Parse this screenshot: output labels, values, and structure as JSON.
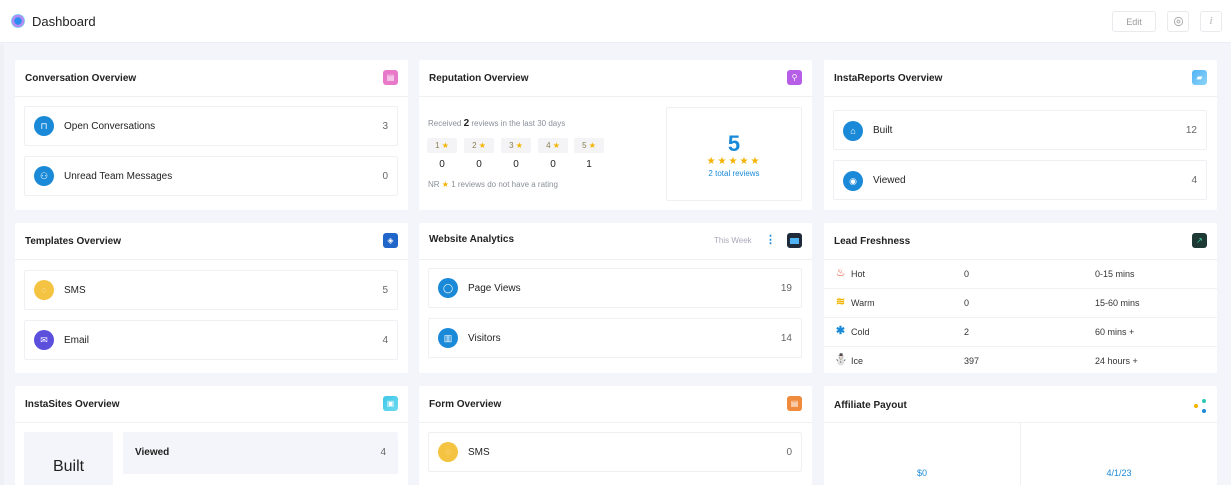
{
  "header": {
    "title": "Dashboard",
    "edit_label": "Edit",
    "settings_icon": "gear-icon",
    "info_icon": "info-icon"
  },
  "conversation": {
    "title": "Conversation Overview",
    "items": [
      {
        "label": "Open Conversations",
        "value": "3",
        "icon": "inbox-icon"
      },
      {
        "label": "Unread Team Messages",
        "value": "0",
        "icon": "team-icon"
      }
    ]
  },
  "reputation": {
    "title": "Reputation Overview",
    "received_prefix": "Received",
    "received_count": "2",
    "received_suffix": "reviews in the last 30 days",
    "ratings": [
      {
        "label": "1",
        "value": "0"
      },
      {
        "label": "2",
        "value": "0"
      },
      {
        "label": "3",
        "value": "0"
      },
      {
        "label": "4",
        "value": "0"
      },
      {
        "label": "5",
        "value": "1"
      }
    ],
    "nr_label": "NR",
    "nr_text": "1 reviews do not have a rating",
    "score": "5",
    "stars": "★★★★★",
    "total_reviews": "2 total reviews"
  },
  "instareports": {
    "title": "InstaReports Overview",
    "items": [
      {
        "label": "Built",
        "value": "12",
        "icon": "building-icon"
      },
      {
        "label": "Viewed",
        "value": "4",
        "icon": "eye-icon"
      }
    ]
  },
  "templates": {
    "title": "Templates Overview",
    "items": [
      {
        "label": "SMS",
        "value": "5",
        "icon": "sms-icon"
      },
      {
        "label": "Email",
        "value": "4",
        "icon": "email-icon"
      }
    ]
  },
  "website_analytics": {
    "title": "Website Analytics",
    "period": "This Week",
    "items": [
      {
        "label": "Page Views",
        "value": "19",
        "icon": "user-icon"
      },
      {
        "label": "Visitors",
        "value": "14",
        "icon": "building-icon"
      }
    ]
  },
  "lead_freshness": {
    "title": "Lead Freshness",
    "rows": [
      {
        "label": "Hot",
        "value": "0",
        "time": "0-15 mins",
        "icon": "flame-icon"
      },
      {
        "label": "Warm",
        "value": "0",
        "time": "15-60 mins",
        "icon": "wave-icon"
      },
      {
        "label": "Cold",
        "value": "2",
        "time": "60 mins +",
        "icon": "snowflake-icon"
      },
      {
        "label": "Ice",
        "value": "397",
        "time": "24 hours +",
        "icon": "ice-icon"
      }
    ]
  },
  "instasites": {
    "title": "InstaSites Overview",
    "built_label": "Built",
    "viewed_label": "Viewed",
    "viewed_value": "4"
  },
  "form_overview": {
    "title": "Form Overview",
    "items": [
      {
        "label": "SMS",
        "value": "0",
        "icon": "sms-icon"
      }
    ]
  },
  "affiliate": {
    "title": "Affiliate Payout",
    "left_value": "$0",
    "right_value": "4/1/23"
  },
  "colors": {
    "accent": "#1a8ad8",
    "star": "#f4b300",
    "page_bg": "#f4f5fa"
  }
}
